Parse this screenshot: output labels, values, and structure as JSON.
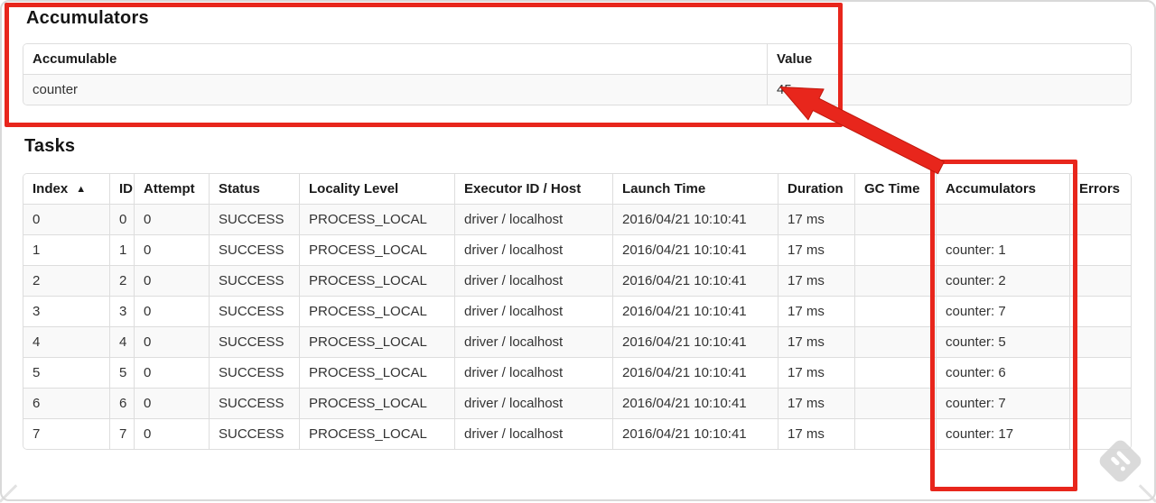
{
  "accumulators_section": {
    "heading": "Accumulators",
    "table": {
      "headers": [
        "Accumulable",
        "Value"
      ],
      "rows": [
        [
          "counter",
          "45"
        ]
      ]
    }
  },
  "tasks_section": {
    "heading": "Tasks",
    "sort_icon": "▲",
    "table": {
      "headers": [
        "Index",
        "ID",
        "Attempt",
        "Status",
        "Locality Level",
        "Executor ID / Host",
        "Launch Time",
        "Duration",
        "GC Time",
        "Accumulators",
        "Errors"
      ],
      "rows": [
        [
          "0",
          "0",
          "0",
          "SUCCESS",
          "PROCESS_LOCAL",
          "driver / localhost",
          "2016/04/21 10:10:41",
          "17 ms",
          "",
          "",
          ""
        ],
        [
          "1",
          "1",
          "0",
          "SUCCESS",
          "PROCESS_LOCAL",
          "driver / localhost",
          "2016/04/21 10:10:41",
          "17 ms",
          "",
          "counter: 1",
          ""
        ],
        [
          "2",
          "2",
          "0",
          "SUCCESS",
          "PROCESS_LOCAL",
          "driver / localhost",
          "2016/04/21 10:10:41",
          "17 ms",
          "",
          "counter: 2",
          ""
        ],
        [
          "3",
          "3",
          "0",
          "SUCCESS",
          "PROCESS_LOCAL",
          "driver / localhost",
          "2016/04/21 10:10:41",
          "17 ms",
          "",
          "counter: 7",
          ""
        ],
        [
          "4",
          "4",
          "0",
          "SUCCESS",
          "PROCESS_LOCAL",
          "driver / localhost",
          "2016/04/21 10:10:41",
          "17 ms",
          "",
          "counter: 5",
          ""
        ],
        [
          "5",
          "5",
          "0",
          "SUCCESS",
          "PROCESS_LOCAL",
          "driver / localhost",
          "2016/04/21 10:10:41",
          "17 ms",
          "",
          "counter: 6",
          ""
        ],
        [
          "6",
          "6",
          "0",
          "SUCCESS",
          "PROCESS_LOCAL",
          "driver / localhost",
          "2016/04/21 10:10:41",
          "17 ms",
          "",
          "counter: 7",
          ""
        ],
        [
          "7",
          "7",
          "0",
          "SUCCESS",
          "PROCESS_LOCAL",
          "driver / localhost",
          "2016/04/21 10:10:41",
          "17 ms",
          "",
          "counter: 17",
          ""
        ]
      ]
    }
  },
  "annotations": {
    "highlight_color": "#e8261c",
    "watermark_icon": "feedly-logo"
  },
  "colors": {
    "row_stripe": "#f9f9f9",
    "table_border": "#dddddd"
  }
}
